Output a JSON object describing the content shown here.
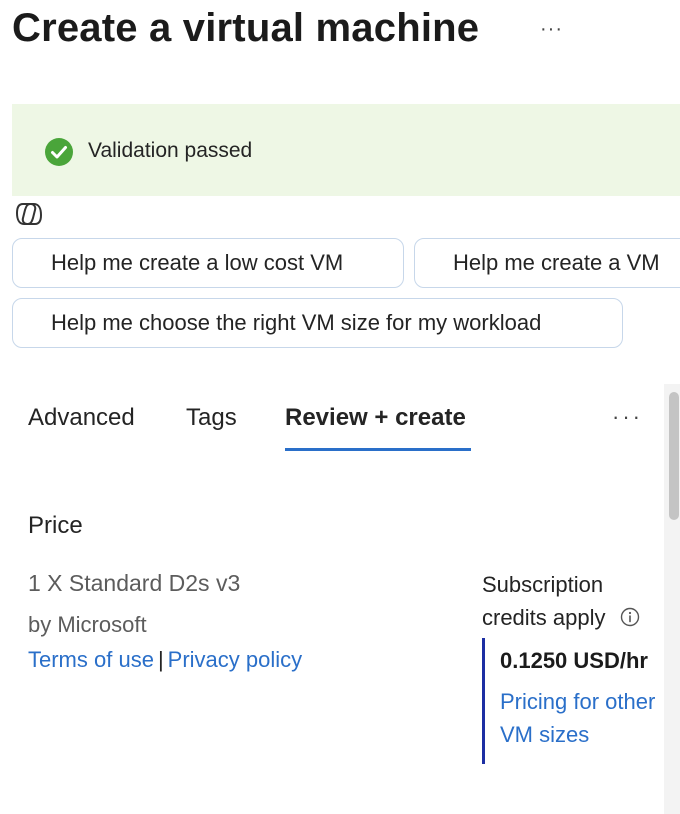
{
  "header": {
    "title": "Create a virtual machine",
    "more_label": "···"
  },
  "validation": {
    "text": "Validation passed",
    "status_color": "#4aa53a",
    "background": "#eef7e5"
  },
  "copilot": {
    "icon": "copilot-icon",
    "suggestions": [
      "Help me create a low cost VM",
      "Help me create a VM",
      "Help me choose the right VM size for my workload"
    ]
  },
  "tabs": {
    "items": [
      "Advanced",
      "Tags",
      "Review + create"
    ],
    "active": "Review + create",
    "more_label": "···",
    "accent": "#2a6fc9"
  },
  "price": {
    "heading": "Price",
    "product": "1 X Standard D2s v3",
    "publisher": "by Microsoft",
    "terms_link": "Terms of use",
    "separator": "|",
    "privacy_link": "Privacy policy",
    "credits_label": "Subscription credits apply",
    "info_icon": "info-icon",
    "value": "0.1250 USD/hr",
    "pricing_link": "Pricing for other VM sizes"
  }
}
